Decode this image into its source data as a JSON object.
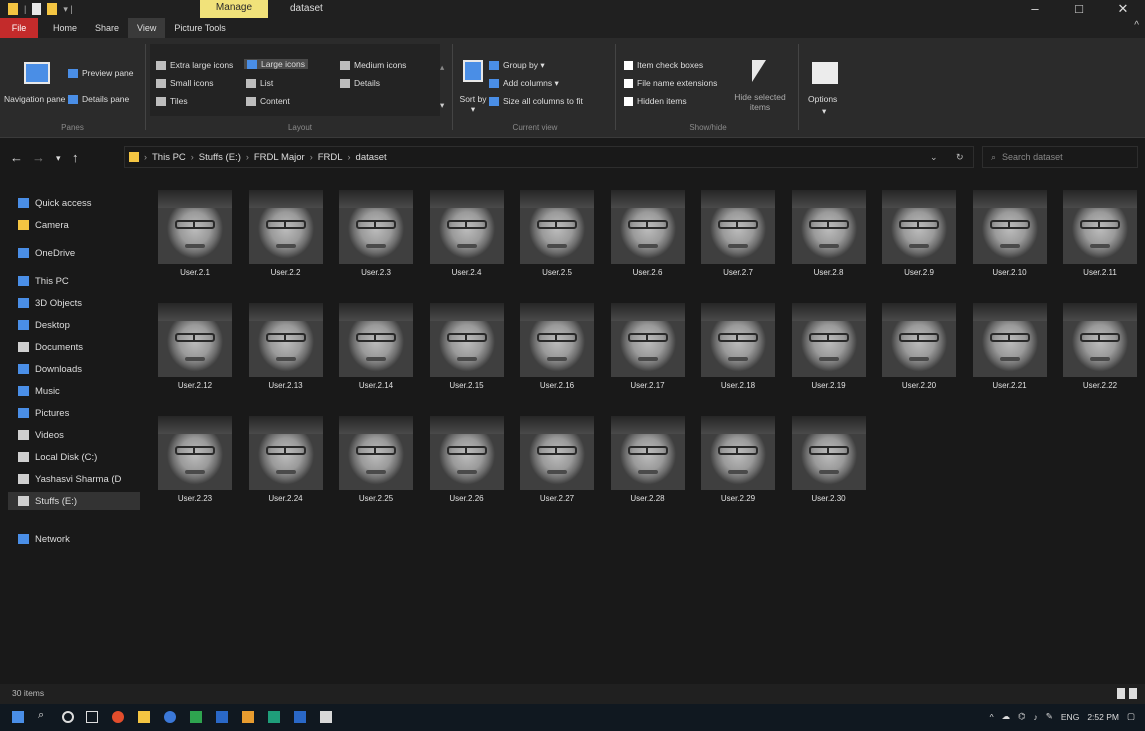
{
  "titlebar": {
    "manage_tab": "Manage",
    "title": "dataset",
    "minimize": "–",
    "maximize": "□",
    "close": "✕"
  },
  "ribbon_tabs": [
    "File",
    "Home",
    "Share",
    "View",
    "Picture Tools"
  ],
  "ribbon": {
    "panes": {
      "navigation_pane": "Navigation pane ▾",
      "preview_pane": "Preview pane",
      "details_pane": "Details pane",
      "label": "Panes"
    },
    "layout": {
      "extra_large": "Extra large icons",
      "large": "Large icons",
      "medium": "Medium icons",
      "small": "Small icons",
      "list": "List",
      "details": "Details",
      "tiles": "Tiles",
      "content": "Content",
      "label": "Layout"
    },
    "current_view": {
      "sort_by": "Sort by ▾",
      "group_by": "Group by ▾",
      "add_columns": "Add columns ▾",
      "size_columns": "Size all columns to fit",
      "label": "Current view"
    },
    "show_hide": {
      "item_checkboxes": "Item check boxes",
      "file_extensions": "File name extensions",
      "hidden_items": "Hidden items",
      "hide_selected": "Hide selected items",
      "label": "Show/hide"
    },
    "options": "Options"
  },
  "address": {
    "breadcrumbs": [
      "This PC",
      "Stuffs (E:)",
      "FRDL Major",
      "FRDL",
      "dataset"
    ],
    "search_placeholder": "Search dataset"
  },
  "nav_pane": [
    {
      "label": "Quick access",
      "icon": "star-icon",
      "color": "#4a8ee6"
    },
    {
      "label": "Camera",
      "icon": "folder-icon",
      "color": "#f4c542"
    },
    {
      "label": "OneDrive",
      "icon": "cloud-icon",
      "color": "#4a8ee6"
    },
    {
      "label": "This PC",
      "icon": "computer-icon",
      "color": "#4a8ee6"
    },
    {
      "label": "3D Objects",
      "icon": "cube-icon",
      "color": "#4a8ee6"
    },
    {
      "label": "Desktop",
      "icon": "desktop-icon",
      "color": "#4a8ee6"
    },
    {
      "label": "Documents",
      "icon": "documents-icon",
      "color": "#cfcfcf"
    },
    {
      "label": "Downloads",
      "icon": "download-icon",
      "color": "#4a8ee6"
    },
    {
      "label": "Music",
      "icon": "music-icon",
      "color": "#4a8ee6"
    },
    {
      "label": "Pictures",
      "icon": "pictures-icon",
      "color": "#4a8ee6"
    },
    {
      "label": "Videos",
      "icon": "videos-icon",
      "color": "#cfcfcf"
    },
    {
      "label": "Local Disk (C:)",
      "icon": "drive-icon",
      "color": "#cfcfcf"
    },
    {
      "label": "Yashasvi Sharma (D",
      "icon": "drive-icon",
      "color": "#cfcfcf"
    },
    {
      "label": "Stuffs (E:)",
      "icon": "drive-icon",
      "color": "#cfcfcf"
    },
    {
      "label": "Network",
      "icon": "network-icon",
      "color": "#4a8ee6"
    }
  ],
  "files": [
    "User.2.1",
    "User.2.2",
    "User.2.3",
    "User.2.4",
    "User.2.5",
    "User.2.6",
    "User.2.7",
    "User.2.8",
    "User.2.9",
    "User.2.10",
    "User.2.11",
    "User.2.12",
    "User.2.13",
    "User.2.14",
    "User.2.15",
    "User.2.16",
    "User.2.17",
    "User.2.18",
    "User.2.19",
    "User.2.20",
    "User.2.21",
    "User.2.22",
    "User.2.23",
    "User.2.24",
    "User.2.25",
    "User.2.26",
    "User.2.27",
    "User.2.28",
    "User.2.29",
    "User.2.30"
  ],
  "status": {
    "items": "30 items"
  },
  "taskbar": {
    "language": "ENG",
    "time": "2:52 PM"
  }
}
